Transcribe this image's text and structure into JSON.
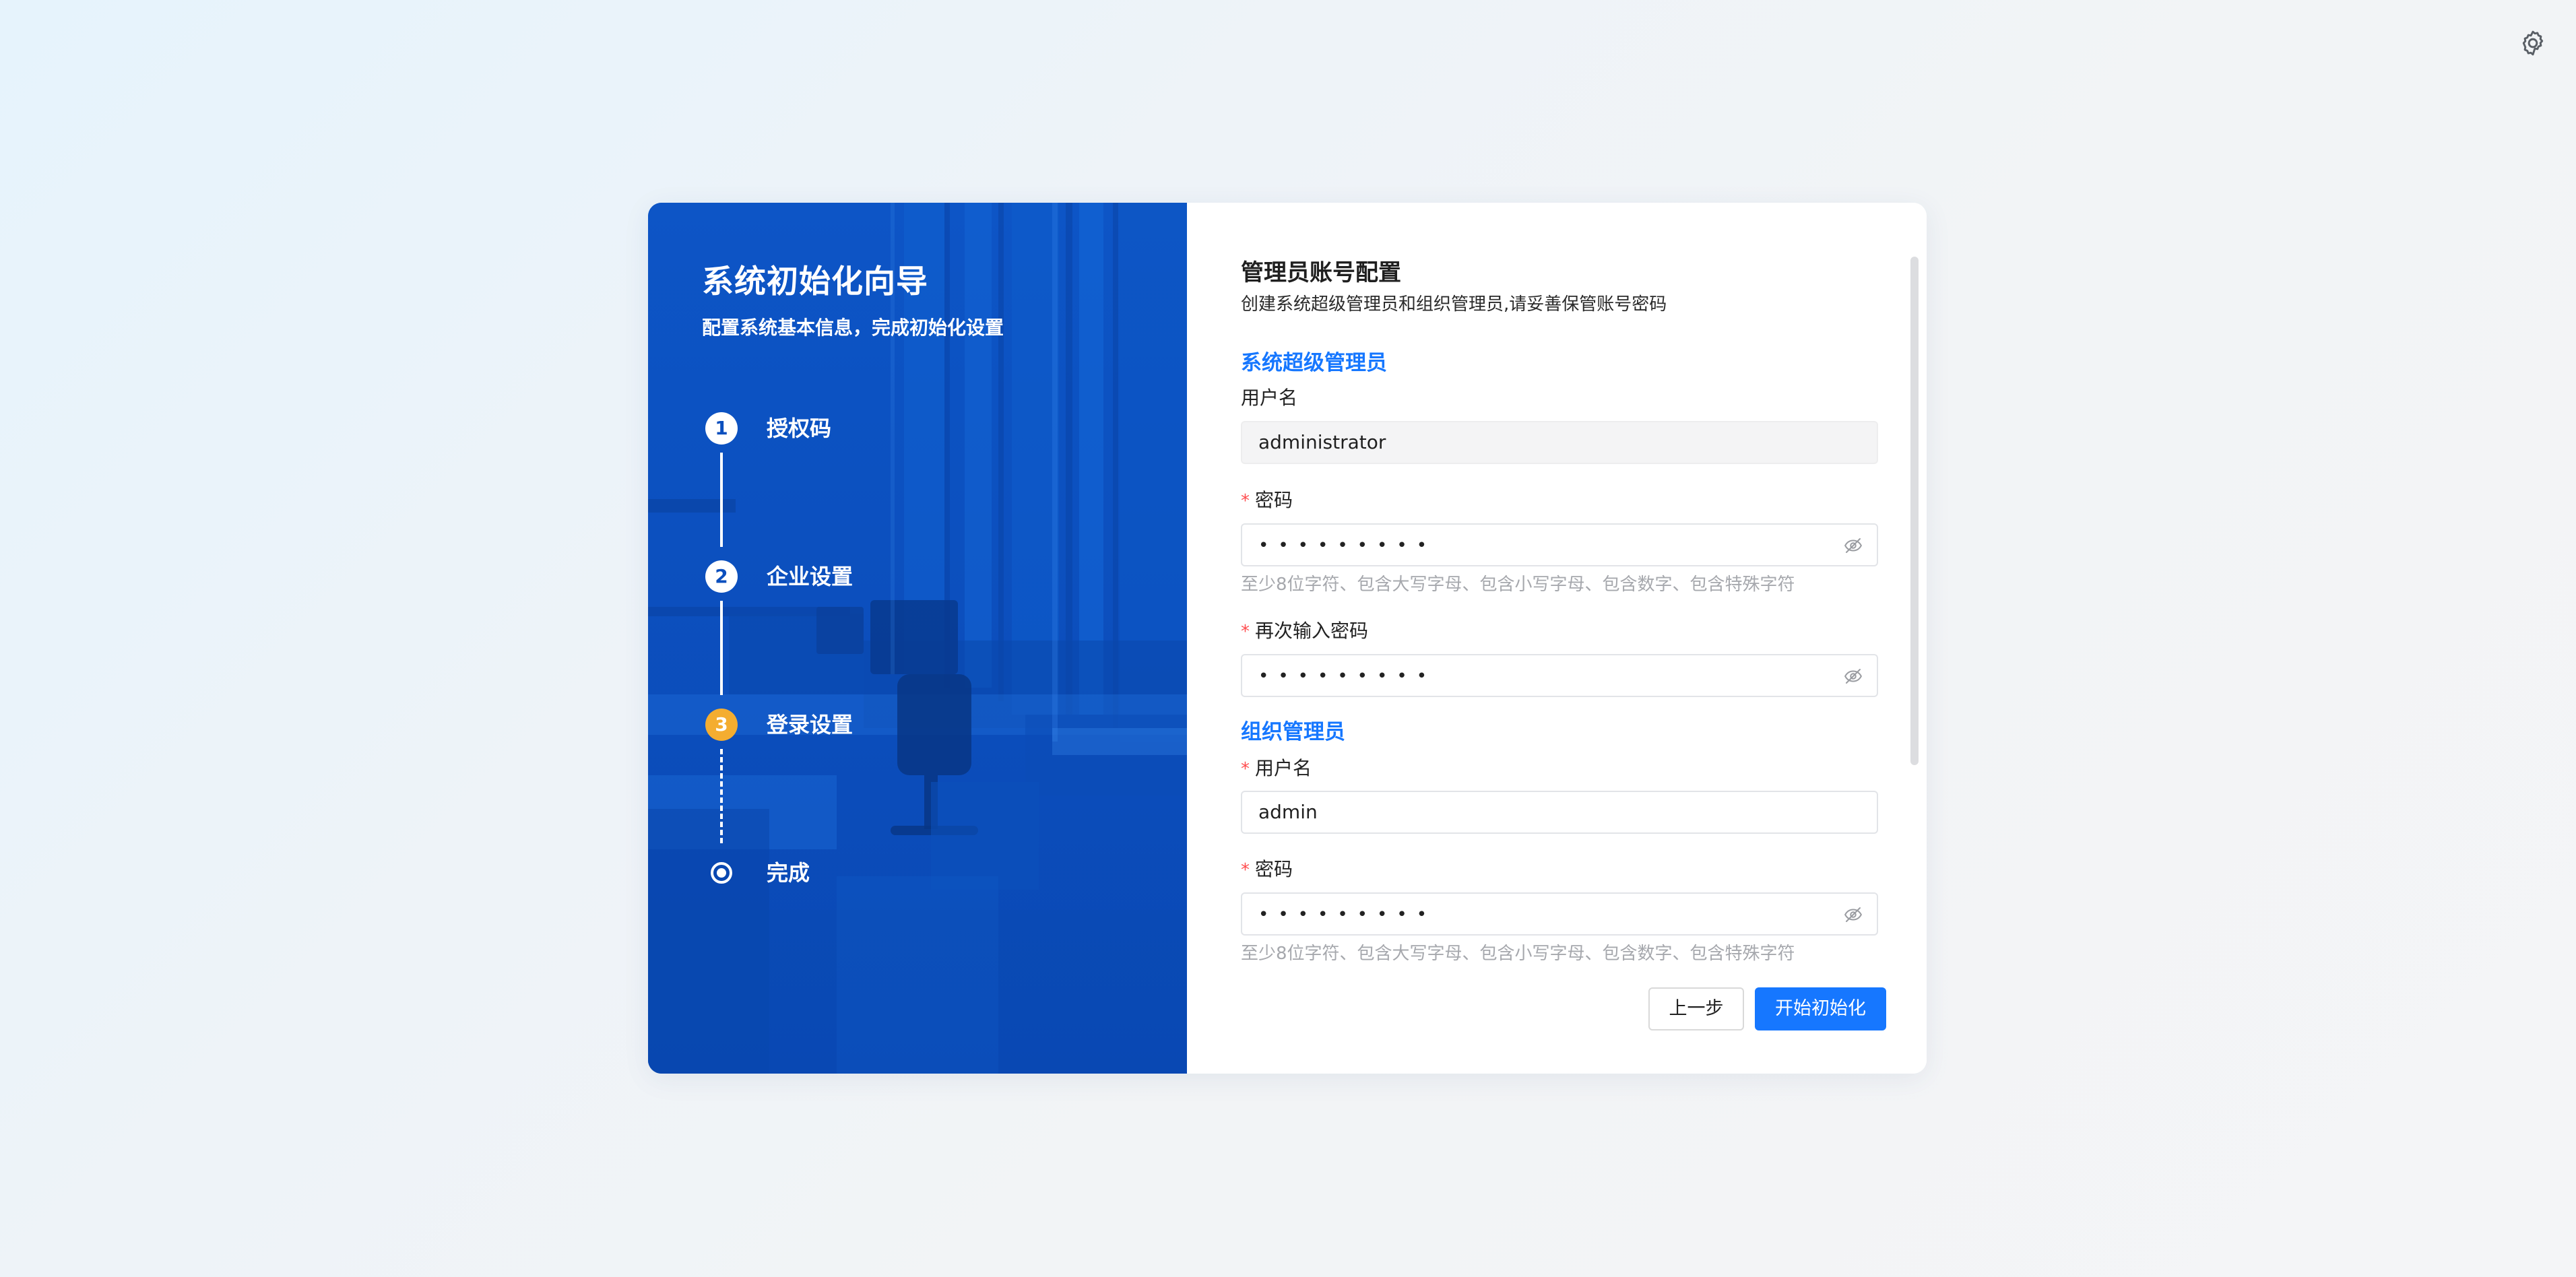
{
  "wizard": {
    "title": "系统初始化向导",
    "subtitle": "配置系统基本信息，完成初始化设置",
    "steps": [
      {
        "number": "1",
        "label": "授权码",
        "status": "done"
      },
      {
        "number": "2",
        "label": "企业设置",
        "status": "done"
      },
      {
        "number": "3",
        "label": "登录设置",
        "status": "current"
      },
      {
        "number": "",
        "label": "完成",
        "status": "pending"
      }
    ]
  },
  "form": {
    "title": "管理员账号配置",
    "description": "创建系统超级管理员和组织管理员,请妥善保管账号密码",
    "super_admin": {
      "group_title": "系统超级管理员",
      "username_label": "用户名",
      "username_value": "administrator",
      "password_label": "密码",
      "password_value": "•••••••••",
      "password_hint": "至少8位字符、包含大写字母、包含小写字母、包含数字、包含特殊字符",
      "confirm_label": "再次输入密码",
      "confirm_value": "•••••••••"
    },
    "org_admin": {
      "group_title": "组织管理员",
      "username_label": "用户名",
      "username_value": "admin",
      "password_label": "密码",
      "password_value": "•••••••••",
      "password_hint": "至少8位字符、包含大写字母、包含小写字母、包含数字、包含特殊字符"
    },
    "required_mark": "*"
  },
  "actions": {
    "prev_label": "上一步",
    "start_label": "开始初始化"
  },
  "icons": {
    "settings": "gear-icon",
    "password_visibility": "eye-off-icon"
  },
  "colors": {
    "primary": "#1677ff",
    "panel_blue": "#0b4fbe",
    "current_step": "#f4ad30",
    "required": "#ff4d4f",
    "hint": "#a6a8ad"
  }
}
